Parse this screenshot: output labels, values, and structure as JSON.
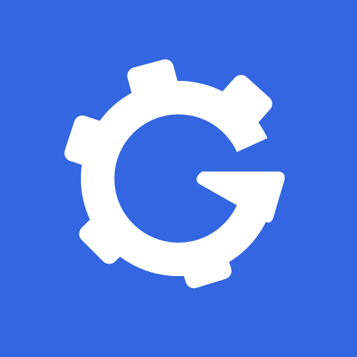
{
  "icon": {
    "name": "gear-refresh-icon",
    "background_color": "#3366e0",
    "glyph_color": "#ffffff"
  }
}
